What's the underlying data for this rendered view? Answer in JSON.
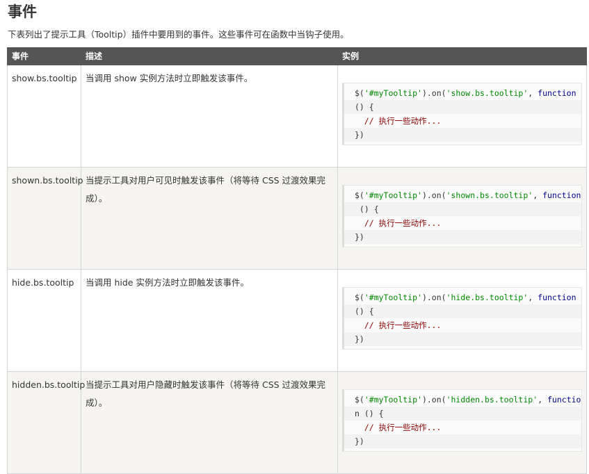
{
  "page": {
    "heading": "事件",
    "intro": "下表列出了提示工具（Tooltip）插件中要用到的事件。这些事件可在函数中当钩子使用。"
  },
  "table": {
    "headers": [
      "事件",
      "描述",
      "实例"
    ],
    "rows": [
      {
        "event": "show.bs.tooltip",
        "description": "当调用 show 实例方法时立即触发该事件。",
        "code": {
          "l1_prefix": "$(",
          "l1_selector": "'#myTooltip'",
          "l1_mid": ").on(",
          "l1_event": "'show.bs.tooltip'",
          "l1_sep": ", ",
          "l1_fn": "function",
          "l2": "() {",
          "l3": "  // 执行一些动作...",
          "l4": "})"
        }
      },
      {
        "event": "shown.bs.tooltip",
        "description": "当提示工具对用户可见时触发该事件（将等待 CSS 过渡效果完成）。",
        "code": {
          "l1_prefix": "$(",
          "l1_selector": "'#myTooltip'",
          "l1_mid": ").on(",
          "l1_event": "'shown.bs.tooltip'",
          "l1_sep": ", ",
          "l1_fn": "function",
          "l2": " () {",
          "l3": "  // 执行一些动作...",
          "l4": "})"
        }
      },
      {
        "event": "hide.bs.tooltip",
        "description": "当调用 hide 实例方法时立即触发该事件。",
        "code": {
          "l1_prefix": "$(",
          "l1_selector": "'#myTooltip'",
          "l1_mid": ").on(",
          "l1_event": "'hide.bs.tooltip'",
          "l1_sep": ", ",
          "l1_fn": "function",
          "l2": "() {",
          "l3": "  // 执行一些动作...",
          "l4": "})"
        }
      },
      {
        "event": "hidden.bs.tooltip",
        "description": "当提示工具对用户隐藏时触发该事件（将等待 CSS 过渡效果完成）。",
        "code": {
          "l1_prefix": "$(",
          "l1_selector": "'#myTooltip'",
          "l1_mid": ").on(",
          "l1_event": "'hidden.bs.tooltip'",
          "l1_sep": ", ",
          "l1_fn": "functio",
          "l2": "n () {",
          "l3": "  // 执行一些动作...",
          "l4": "})"
        }
      }
    ]
  },
  "colors": {
    "header_bg": "#555555",
    "row_even_bg": "#f6f4f0",
    "string": "#008800",
    "keyword": "#000088",
    "comment": "#880000"
  }
}
